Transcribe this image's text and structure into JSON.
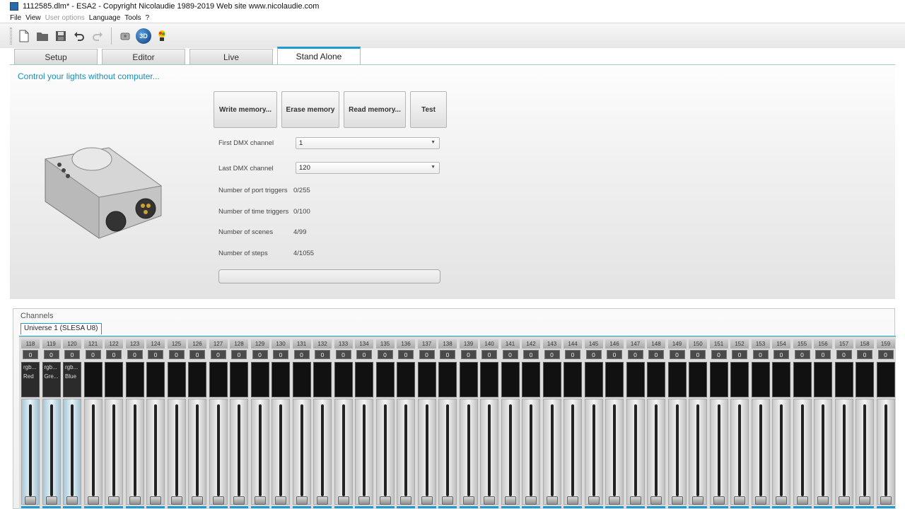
{
  "window": {
    "title": "1112585.dlm* - ESA2 - Copyright Nicolaudie 1989-2019 Web site www.nicolaudie.com"
  },
  "menu": {
    "items": [
      "File",
      "View",
      "User options",
      "Language",
      "Tools",
      "?"
    ],
    "disabled": [
      "User options"
    ]
  },
  "toolbar": {
    "btn3d_label": "3D"
  },
  "tabs": [
    {
      "label": "Setup",
      "active": false
    },
    {
      "label": "Editor",
      "active": false
    },
    {
      "label": "Live",
      "active": false
    },
    {
      "label": "Stand Alone",
      "active": true
    }
  ],
  "main": {
    "subtitle": "Control your lights without computer...",
    "buttons": {
      "write": "Write memory...",
      "erase": "Erase memory",
      "read": "Read memory...",
      "test": "Test"
    },
    "first_dmx_label": "First DMX channel",
    "first_dmx_value": "1",
    "last_dmx_label": "Last DMX channel",
    "last_dmx_value": "120",
    "port_triggers_label": "Number of port triggers",
    "port_triggers_value": "0/255",
    "time_triggers_label": "Number of time triggers",
    "time_triggers_value": "0/100",
    "scenes_label": "Number of scenes",
    "scenes_value": "4/99",
    "steps_label": "Number of steps",
    "steps_value": "4/1055",
    "progress": 0
  },
  "channels": {
    "title": "Channels",
    "universe_tab": "Universe 1 (SLESA U8)",
    "strips": [
      {
        "num": "118",
        "value": "0",
        "line1": "rgb...",
        "line2": "Red",
        "active": true
      },
      {
        "num": "119",
        "value": "0",
        "line1": "rgb...",
        "line2": "Gre...",
        "active": true
      },
      {
        "num": "120",
        "value": "0",
        "line1": "rgb...",
        "line2": "Blue",
        "active": true
      },
      {
        "num": "121",
        "value": "0"
      },
      {
        "num": "122",
        "value": "0"
      },
      {
        "num": "123",
        "value": "0"
      },
      {
        "num": "124",
        "value": "0"
      },
      {
        "num": "125",
        "value": "0"
      },
      {
        "num": "126",
        "value": "0"
      },
      {
        "num": "127",
        "value": "0"
      },
      {
        "num": "128",
        "value": "0"
      },
      {
        "num": "129",
        "value": "0"
      },
      {
        "num": "130",
        "value": "0"
      },
      {
        "num": "131",
        "value": "0"
      },
      {
        "num": "132",
        "value": "0"
      },
      {
        "num": "133",
        "value": "0"
      },
      {
        "num": "134",
        "value": "0"
      },
      {
        "num": "135",
        "value": "0"
      },
      {
        "num": "136",
        "value": "0"
      },
      {
        "num": "137",
        "value": "0"
      },
      {
        "num": "138",
        "value": "0"
      },
      {
        "num": "139",
        "value": "0"
      },
      {
        "num": "140",
        "value": "0"
      },
      {
        "num": "141",
        "value": "0"
      },
      {
        "num": "142",
        "value": "0"
      },
      {
        "num": "143",
        "value": "0"
      },
      {
        "num": "144",
        "value": "0"
      },
      {
        "num": "145",
        "value": "0"
      },
      {
        "num": "146",
        "value": "0"
      },
      {
        "num": "147",
        "value": "0"
      },
      {
        "num": "148",
        "value": "0"
      },
      {
        "num": "149",
        "value": "0"
      },
      {
        "num": "150",
        "value": "0"
      },
      {
        "num": "151",
        "value": "0"
      },
      {
        "num": "152",
        "value": "0"
      },
      {
        "num": "153",
        "value": "0"
      },
      {
        "num": "154",
        "value": "0"
      },
      {
        "num": "155",
        "value": "0"
      },
      {
        "num": "156",
        "value": "0"
      },
      {
        "num": "157",
        "value": "0"
      },
      {
        "num": "158",
        "value": "0"
      },
      {
        "num": "159",
        "value": "0"
      }
    ]
  }
}
